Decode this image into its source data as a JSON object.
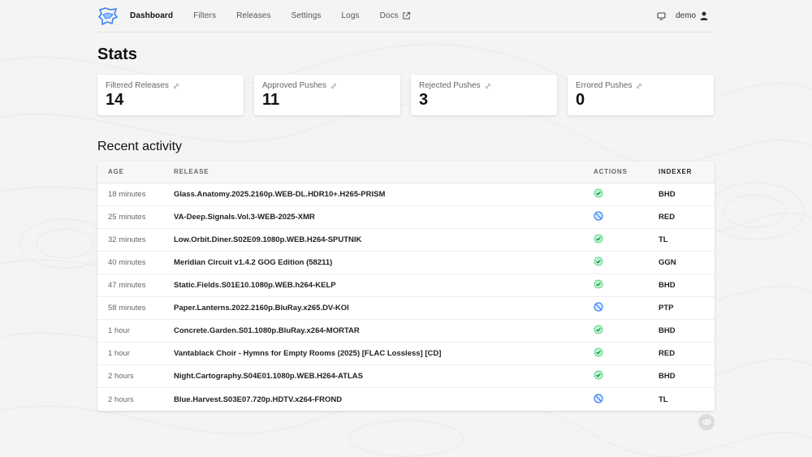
{
  "nav": {
    "links": [
      "Dashboard",
      "Filters",
      "Releases",
      "Settings",
      "Logs",
      "Docs"
    ],
    "user": "demo"
  },
  "stats": {
    "title": "Stats",
    "cards": [
      {
        "label": "Filtered Releases",
        "value": "14"
      },
      {
        "label": "Approved Pushes",
        "value": "11"
      },
      {
        "label": "Rejected Pushes",
        "value": "3"
      },
      {
        "label": "Errored Pushes",
        "value": "0"
      }
    ]
  },
  "activity": {
    "title": "Recent activity",
    "columns": [
      "Age",
      "Release",
      "Actions",
      "Indexer"
    ],
    "rows": [
      {
        "age": "18 minutes",
        "release": "Glass.Anatomy.2025.2160p.WEB-DL.HDR10+.H265-PRISM",
        "action": "approved",
        "indexer": "BHD"
      },
      {
        "age": "25 minutes",
        "release": "VA-Deep.Signals.Vol.3-WEB-2025-XMR",
        "action": "rejected",
        "indexer": "RED"
      },
      {
        "age": "32 minutes",
        "release": "Low.Orbit.Diner.S02E09.1080p.WEB.H264-SPUTNIK",
        "action": "approved",
        "indexer": "TL"
      },
      {
        "age": "40 minutes",
        "release": "Meridian Circuit v1.4.2 GOG Edition (58211)",
        "action": "approved",
        "indexer": "GGN"
      },
      {
        "age": "47 minutes",
        "release": "Static.Fields.S01E10.1080p.WEB.h264-KELP",
        "action": "approved",
        "indexer": "BHD"
      },
      {
        "age": "58 minutes",
        "release": "Paper.Lanterns.2022.2160p.BluRay.x265.DV-KOI",
        "action": "rejected",
        "indexer": "PTP"
      },
      {
        "age": "1 hour",
        "release": "Concrete.Garden.S01.1080p.BluRay.x264-MORTAR",
        "action": "approved",
        "indexer": "BHD"
      },
      {
        "age": "1 hour",
        "release": "Vantablack Choir - Hymns for Empty Rooms (2025) [FLAC Lossless] [CD]",
        "action": "approved",
        "indexer": "RED"
      },
      {
        "age": "2 hours",
        "release": "Night.Cartography.S04E01.1080p.WEB.H264-ATLAS",
        "action": "approved",
        "indexer": "BHD"
      },
      {
        "age": "2 hours",
        "release": "Blue.Harvest.S03E07.720p.HDTV.x264-FROND",
        "action": "rejected",
        "indexer": "TL"
      }
    ]
  },
  "icons": {
    "approved": "check-badge-icon",
    "rejected": "no-entry-icon",
    "link": "link-icon",
    "monitor": "monitor-icon",
    "user": "user-icon",
    "external": "external-link-icon"
  },
  "colors": {
    "approved": "#22c55e",
    "rejected": "#3b82f6"
  }
}
